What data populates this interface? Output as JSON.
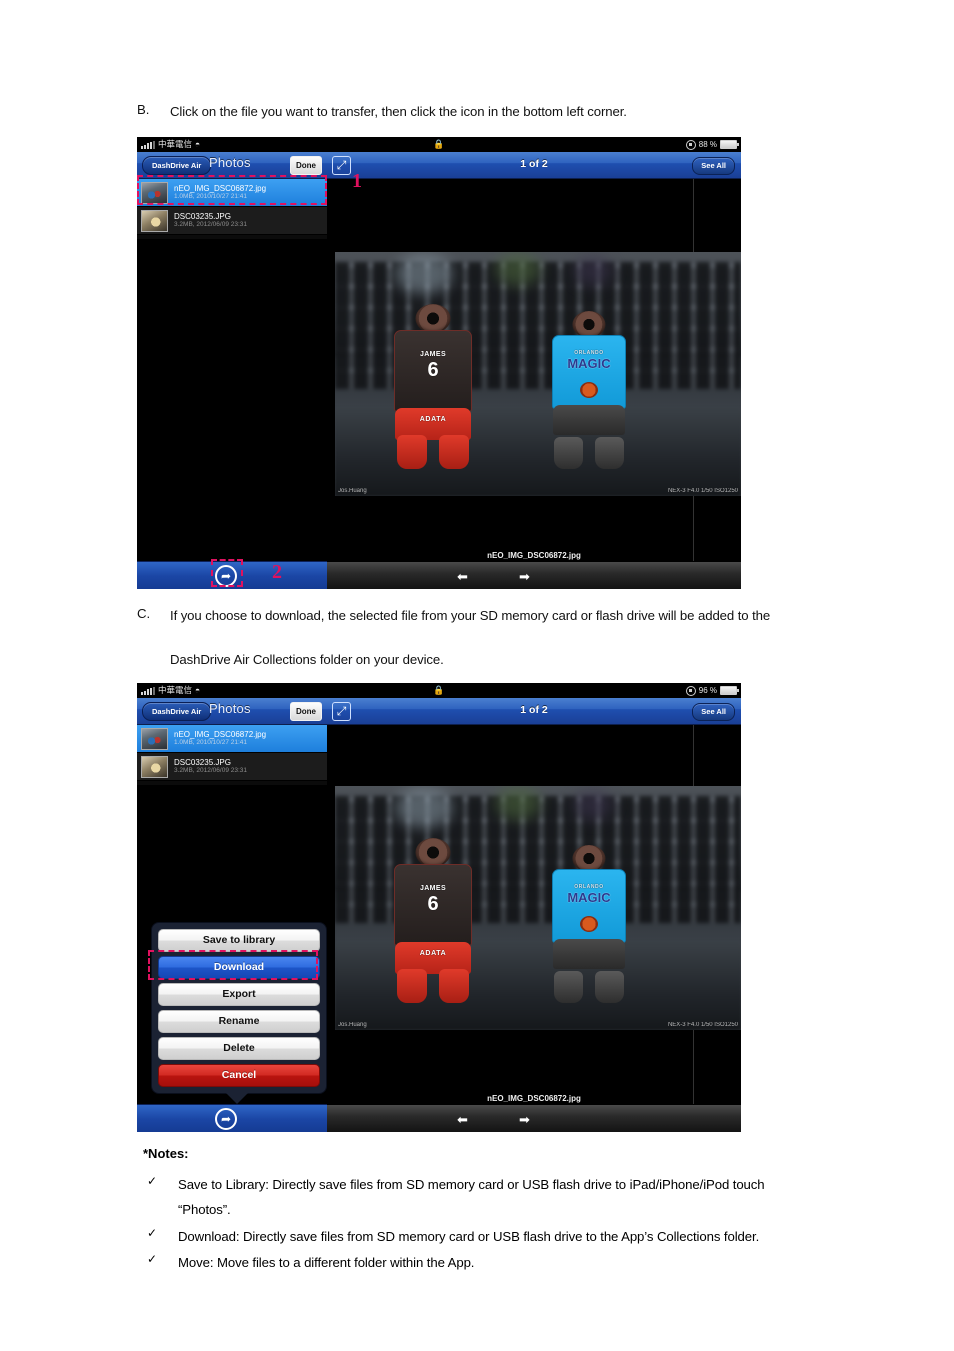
{
  "document": {
    "step_b": {
      "marker": "B.",
      "text": "Click on the file you want to transfer, then click the icon in the bottom left corner."
    },
    "step_c": {
      "marker": "C.",
      "line1": "If you choose to download, the selected file from your SD memory card or flash drive will be added to the",
      "line2": "DashDrive Air Collections folder on your device."
    },
    "notes": {
      "title": "*Notes:",
      "check_glyph": "✓",
      "items": [
        "Save to Library: Directly save files from SD memory card or USB flash drive to iPad/iPhone/iPod touch",
        "“Photos”.",
        "Download: Directly save files from SD memory card or USB flash drive to the App’s Collections folder.",
        "Move: Move files to a different folder within the App."
      ]
    }
  },
  "screenshot_top": {
    "statusbar": {
      "carrier": "中華電信",
      "wifi_icon": "wifi-icon",
      "signal_icon": "signal-bars-icon",
      "lock_icon": "🔒",
      "rotation_lock_icon": "rotation-lock-icon",
      "battery_percent": "88 %"
    },
    "navbar_left": {
      "back_label": "DashDrive Air",
      "title": "Photos",
      "done_label": "Done"
    },
    "navbar_right": {
      "expand_icon": "⤢",
      "page_indicator": "1 of 2",
      "see_all_label": "See All"
    },
    "files": [
      {
        "name": "nEO_IMG_DSC06872.jpg",
        "meta": "1.0MB, 2010/10/27 21:41",
        "selected": true
      },
      {
        "name": "DSC03235.JPG",
        "meta": "3.2MB, 2012/06/09 23:31",
        "selected": false
      }
    ],
    "photo": {
      "credit_left": "Jos.Huang",
      "credit_right": "NEX-3 F4.0 1/50 ISO1250",
      "figure_left": {
        "player_name": "JAMES",
        "number": "6",
        "brand": "ADATA"
      },
      "figure_right": {
        "team_city": "ORLANDO",
        "team_name": "MAGIC"
      }
    },
    "bottombar": {
      "share_icon": "➦",
      "filename_caption": "nEO_IMG_DSC06872.jpg",
      "prev_icon": "⬅",
      "next_icon": "➡"
    },
    "annotations": [
      {
        "label": "1"
      },
      {
        "label": "2"
      }
    ]
  },
  "screenshot_bottom": {
    "statusbar": {
      "carrier": "中華電信",
      "wifi_icon": "wifi-icon",
      "signal_icon": "signal-bars-icon",
      "lock_icon": "🔒",
      "rotation_lock_icon": "rotation-lock-icon",
      "battery_percent": "96 %"
    },
    "navbar_left": {
      "back_label": "DashDrive Air",
      "title": "Photos",
      "done_label": "Done"
    },
    "navbar_right": {
      "expand_icon": "⤢",
      "page_indicator": "1 of 2",
      "see_all_label": "See All"
    },
    "files": [
      {
        "name": "nEO_IMG_DSC06872.jpg",
        "meta": "1.0MB, 2010/10/27 21:41",
        "selected": true
      },
      {
        "name": "DSC03235.JPG",
        "meta": "3.2MB, 2012/06/09 23:31",
        "selected": false
      }
    ],
    "photo": {
      "credit_left": "Jos.Huang",
      "credit_right": "NEX-3 F4.0 1/50 ISO1250",
      "figure_left": {
        "player_name": "JAMES",
        "number": "6",
        "brand": "ADATA"
      },
      "figure_right": {
        "team_city": "ORLANDO",
        "team_name": "MAGIC"
      }
    },
    "action_sheet": {
      "buttons": [
        {
          "label": "Save to library",
          "style": "default"
        },
        {
          "label": "Download",
          "style": "highlight"
        },
        {
          "label": "Export",
          "style": "default"
        },
        {
          "label": "Rename",
          "style": "default"
        },
        {
          "label": "Delete",
          "style": "default"
        },
        {
          "label": "Cancel",
          "style": "danger"
        }
      ]
    },
    "bottombar": {
      "share_icon": "➦",
      "filename_caption": "nEO_IMG_DSC06872.jpg",
      "prev_icon": "⬅",
      "next_icon": "➡"
    }
  },
  "colors": {
    "annotation": "#e0115f",
    "selected_row": "#2f8fe8",
    "navbar_blue": "#1f4fb0",
    "danger_red": "#c21c14"
  }
}
